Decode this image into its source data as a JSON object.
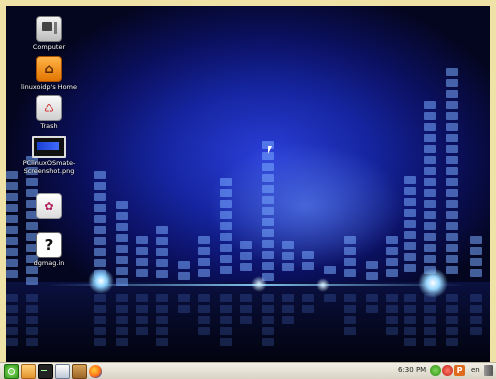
{
  "desktop": {
    "icons": [
      {
        "label": "Computer",
        "icon": "computer-icon"
      },
      {
        "label": "linuxoidp's Home",
        "icon": "home-folder-icon"
      },
      {
        "label": "Trash",
        "icon": "trash-icon"
      },
      {
        "label": "PClinuxOSmate-\nScreenshot.png",
        "icon": "image-file-icon"
      },
      {
        "label": "",
        "icon": "app-launcher-icon"
      },
      {
        "label": "dgmag.in",
        "icon": "help-file-icon"
      }
    ]
  },
  "panel": {
    "launchers": [
      "menu-icon",
      "file-manager-icon",
      "terminal-icon",
      "control-center-icon",
      "package-manager-icon",
      "firefox-icon"
    ],
    "clock": "6:30 PM",
    "tray": {
      "network": "network-icon",
      "updates": "update-notifier-icon",
      "pclinuxos": "P",
      "language": "en",
      "volume": "volume-icon"
    }
  },
  "colors": {
    "background_dark": "#040620",
    "background_blue": "#2a3ed8",
    "panel_bg": "#f2efe6",
    "outer_frame": "#efe2a6"
  }
}
